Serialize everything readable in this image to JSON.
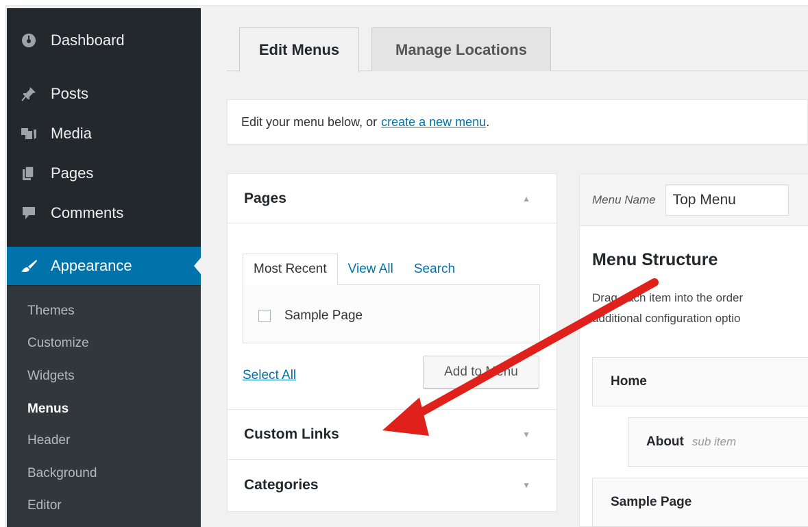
{
  "sidebar": {
    "items": [
      {
        "label": "Dashboard",
        "icon": "dashboard-icon"
      },
      {
        "label": "Posts",
        "icon": "pin-icon"
      },
      {
        "label": "Media",
        "icon": "media-icon"
      },
      {
        "label": "Pages",
        "icon": "pages-icon"
      },
      {
        "label": "Comments",
        "icon": "comment-icon"
      },
      {
        "label": "Appearance",
        "icon": "brush-icon"
      }
    ],
    "submenu": [
      "Themes",
      "Customize",
      "Widgets",
      "Menus",
      "Header",
      "Background",
      "Editor"
    ],
    "active_color": "#0073aa"
  },
  "tabs": {
    "edit": "Edit Menus",
    "locations": "Manage Locations"
  },
  "notice": {
    "text": "Edit your menu below, or",
    "link": "create a new menu",
    "end": "."
  },
  "pages_panel": {
    "title": "Pages",
    "tabs": [
      "Most Recent",
      "View All",
      "Search"
    ],
    "checkbox_label": "Sample Page",
    "select_all": "Select All",
    "add_button": "Add to Menu",
    "custom_links": "Custom Links",
    "categories": "Categories"
  },
  "menu": {
    "name_label": "Menu Name",
    "name_value": "Top Menu",
    "structure_title": "Menu Structure",
    "desc_line1": "Drag each item into the order",
    "desc_line2": "additional configuration optio",
    "items": [
      {
        "label": "Home"
      },
      {
        "label": "About",
        "sub": "sub item"
      },
      {
        "label": "Sample Page"
      }
    ]
  },
  "annotation_color": "#e0201b"
}
